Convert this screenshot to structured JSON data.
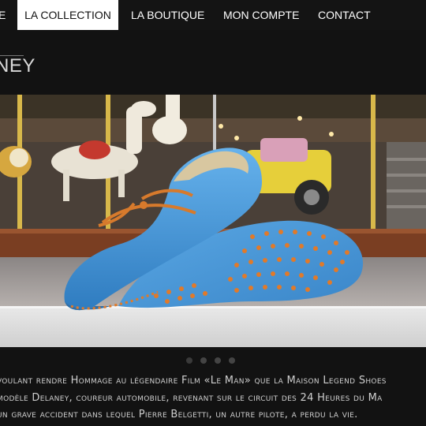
{
  "nav": {
    "items": [
      {
        "label": "E"
      },
      {
        "label": "LA COLLECTION"
      },
      {
        "label": "LA BOUTIQUE"
      },
      {
        "label": "MON COMPTE"
      },
      {
        "label": "CONTACT"
      }
    ]
  },
  "page": {
    "title": "NEY"
  },
  "hero": {
    "slide_count": 4,
    "active_slide": 0,
    "colors": {
      "shoe": "#3f8fd0",
      "laces": "#d77a2c",
      "studs": "#e07a2a",
      "carousel_pink": "#d9a0b8",
      "carousel_yellow": "#e6cf3a"
    }
  },
  "caption": {
    "lines": [
      "voulant rendre Hommage au légendaire Film «Le Man» que la Maison Legend Shoes",
      "modèle Delaney, coureur automobile, revenant sur le circuit des 24 Heures du Ma",
      "un grave accident dans lequel Pierre Belgetti, un autre pilote, a perdu la vie."
    ]
  }
}
